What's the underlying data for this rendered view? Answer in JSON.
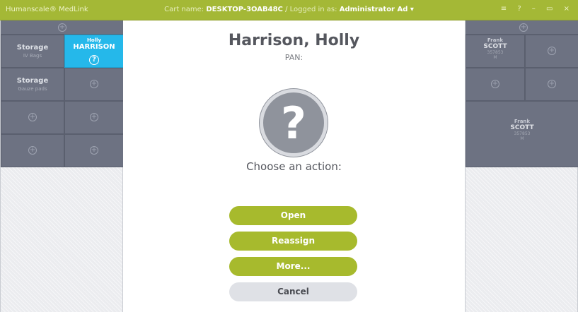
{
  "titlebar": {
    "app_name": "Humanscale® MedLink",
    "cart_label": "Cart name:",
    "cart_name": "DESKTOP-3OAB48C",
    "separator": "/",
    "logged_label": "Logged in as:",
    "user": "Administrator Ad ▾",
    "controls": "≡ ? – ▭ ×"
  },
  "left_grid": {
    "head_plus": "+",
    "cells": [
      {
        "title": "Storage",
        "subtitle": "IV Bags"
      },
      {
        "first_name": "Holly",
        "last_name": "HARRISON",
        "icon": "?"
      },
      {
        "title": "Storage",
        "subtitle": "Gauze pads"
      },
      {
        "plus": "+"
      },
      {
        "plus": "+"
      },
      {
        "plus": "+"
      },
      {
        "plus": "+"
      },
      {
        "plus": "+"
      }
    ]
  },
  "right_grid": {
    "head_plus": "+",
    "cells": [
      {
        "first_name": "Frank",
        "last_name": "SCOTT",
        "id": "357853",
        "sex": "M"
      },
      {
        "plus": "+"
      },
      {
        "plus": "+"
      },
      {
        "plus": "+"
      },
      {
        "first_name": "Frank",
        "last_name": "SCOTT",
        "id": "357853",
        "sex": "M"
      }
    ]
  },
  "modal": {
    "patient_name": "Harrison, Holly",
    "pan": "PAN:",
    "icon": "?",
    "prompt": "Choose an action:",
    "buttons": {
      "open": "Open",
      "reassign": "Reassign",
      "more": "More...",
      "cancel": "Cancel"
    }
  },
  "colors": {
    "accent": "#a7ba2d",
    "titlebar": "#a4b836",
    "selected_cell": "#25b8ea",
    "cell": "#6d7282"
  }
}
